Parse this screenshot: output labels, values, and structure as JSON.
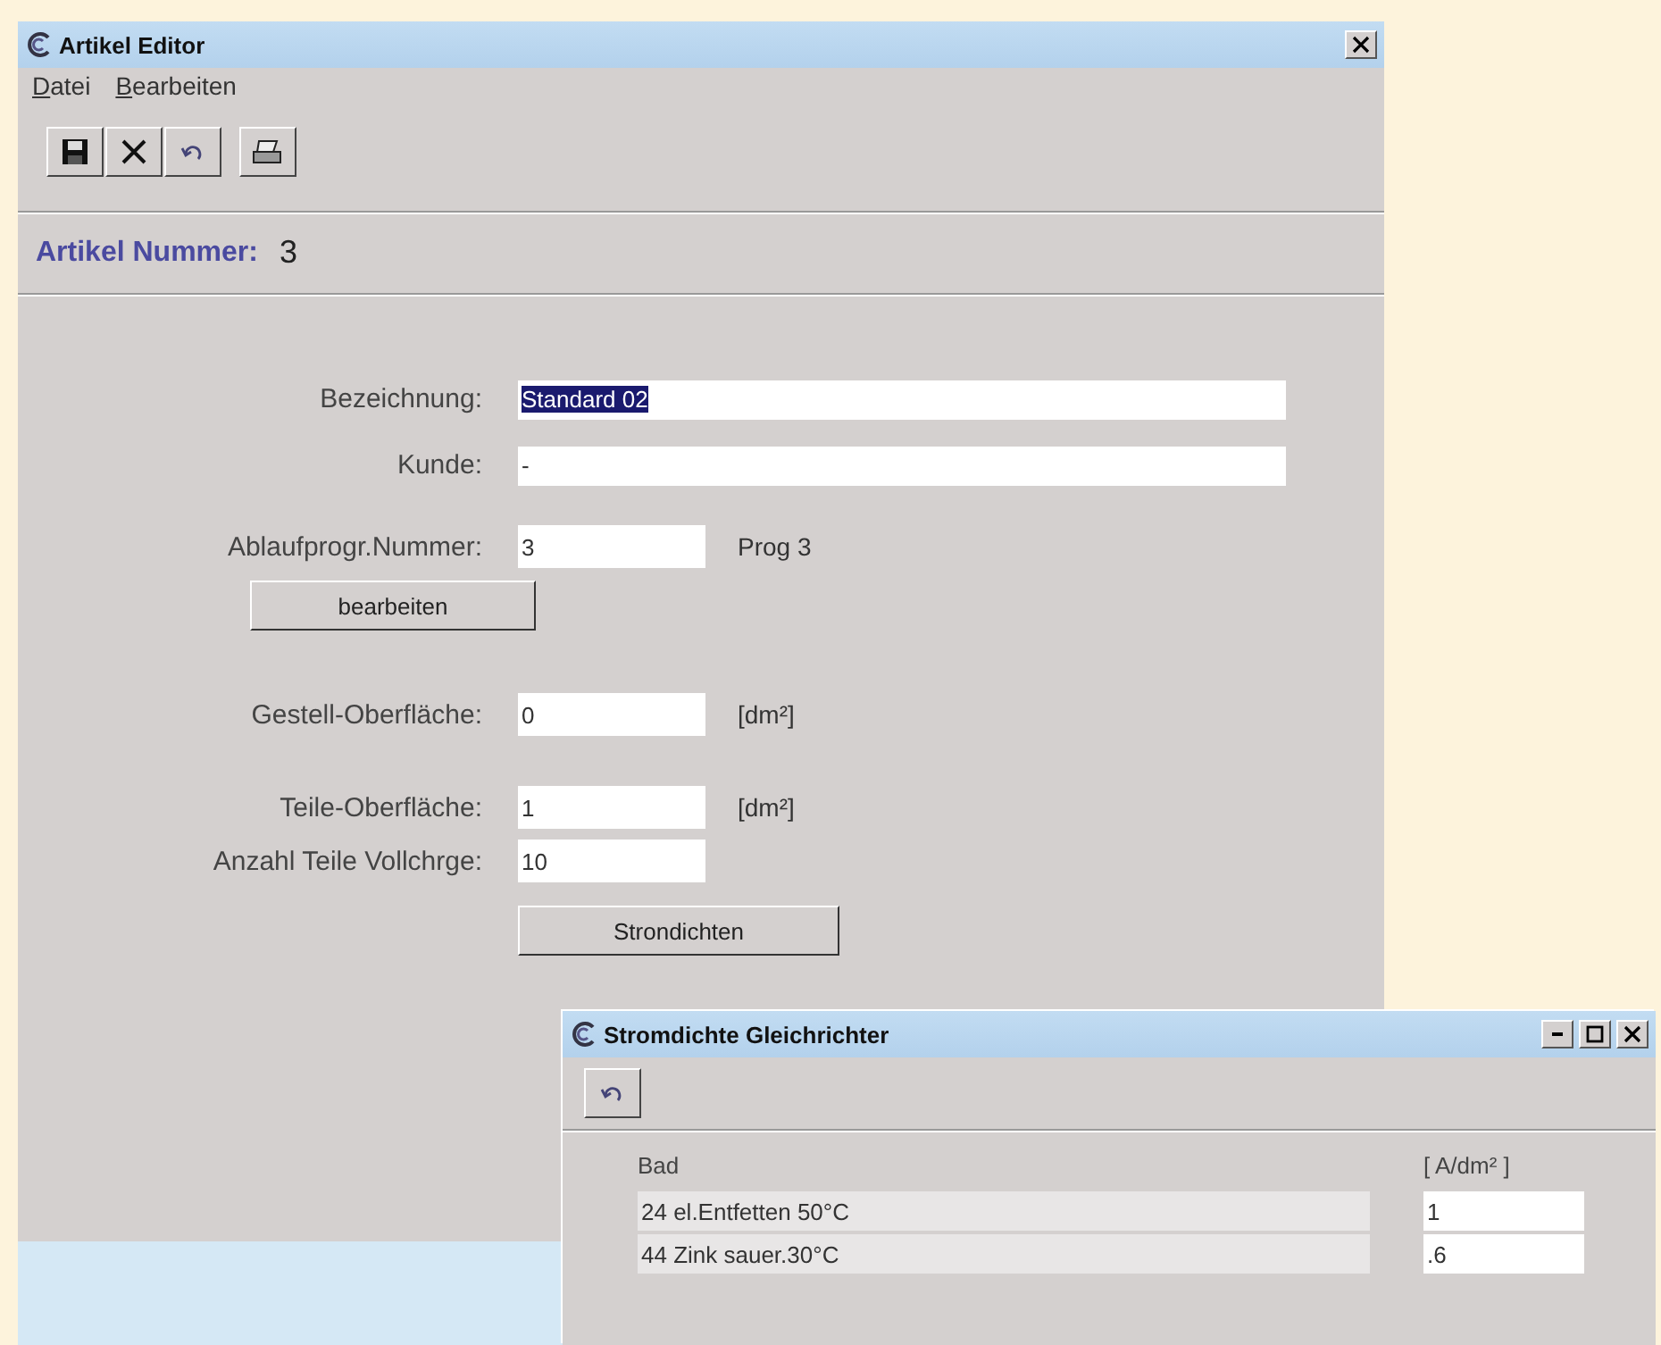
{
  "main_window": {
    "title": "Artikel Editor",
    "menu": [
      "Datei",
      "Bearbeiten"
    ],
    "article_number": {
      "label": "Artikel Nummer:",
      "value": "3"
    },
    "rows": [
      {
        "kind": "field",
        "label": "Bezeichnung:",
        "value": "Standard 02",
        "selected": true
      },
      {
        "kind": "field",
        "label": "Kunde:",
        "value": "-",
        "selected": false
      },
      {
        "kind": "short_field",
        "label": "Ablaufprogr.Nummer:",
        "value": "3",
        "note": "Prog 3"
      },
      {
        "kind": "label_button",
        "label": "bearbeiten"
      },
      {
        "kind": "short_field",
        "label": "Gestell-Oberfläche:",
        "value": "0",
        "note": "[dm²]"
      },
      {
        "kind": "short_field",
        "label": "Teile-Oberfläche:",
        "value": "1",
        "note": "[dm²]"
      },
      {
        "kind": "short_field",
        "label": "Anzahl Teile Vollchrge:",
        "value": "10"
      },
      {
        "kind": "field_button",
        "label": "Strondichten"
      }
    ]
  },
  "dialog": {
    "title": "Stromdichte Gleichrichter",
    "columns": [
      "Bad",
      "[ A/dm² ]"
    ],
    "rows": [
      {
        "bath": "24 el.Entfetten 50°C",
        "value": "1"
      },
      {
        "bath": "44 Zink sauer.30°C",
        "value": ".6"
      }
    ]
  }
}
